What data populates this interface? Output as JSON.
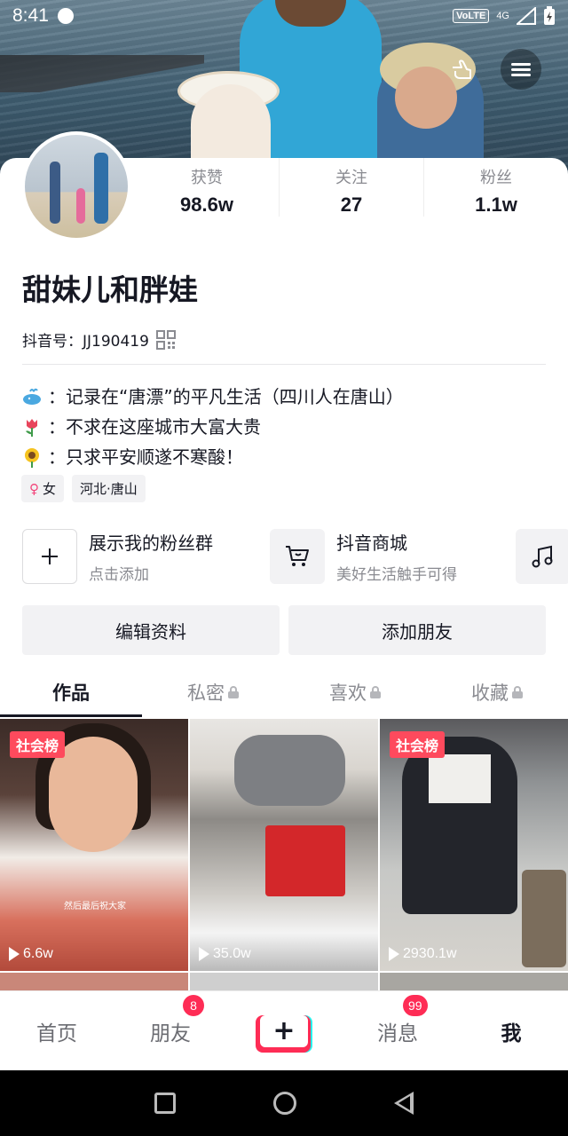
{
  "statusbar": {
    "time": "8:41",
    "volte": "VoLTE",
    "network": "4G"
  },
  "profile": {
    "name": "甜妹儿和胖娃",
    "douyin_id": "抖音号：JJ190419",
    "stats": [
      {
        "label": "获赞",
        "value": "98.6w"
      },
      {
        "label": "关注",
        "value": "27"
      },
      {
        "label": "粉丝",
        "value": "1.1w"
      }
    ],
    "bio": [
      "：记录在“唐漂”的平凡生活（四川人在唐山）",
      "：不求在这座城市大富大贵",
      "：只求平安顺遂不寒酸！"
    ],
    "tags": {
      "gender": "女",
      "location": "河北·唐山"
    }
  },
  "entries": {
    "fans": {
      "title": "展示我的粉丝群",
      "subtitle": "点击添加"
    },
    "shop": {
      "title": "抖音商城",
      "subtitle": "美好生活触手可得"
    }
  },
  "buttons": {
    "edit": "编辑资料",
    "add_friend": "添加朋友"
  },
  "tabs": [
    "作品",
    "私密",
    "喜欢",
    "收藏"
  ],
  "videos": [
    {
      "badge": "社会榜",
      "caption": "然后最后祝大家",
      "plays": "6.6w"
    },
    {
      "badge": "",
      "caption": "",
      "plays": "35.0w"
    },
    {
      "badge": "社会榜",
      "caption": "",
      "plays": "2930.1w"
    }
  ],
  "bottom_nav": {
    "home": "首页",
    "friends": "朋友",
    "friends_badge": "8",
    "plus": "+",
    "messages": "消息",
    "messages_badge": "99",
    "me": "我"
  },
  "colors": {
    "accent": "#fe2c55",
    "cyan": "#25f4ee",
    "text": "#161823"
  }
}
